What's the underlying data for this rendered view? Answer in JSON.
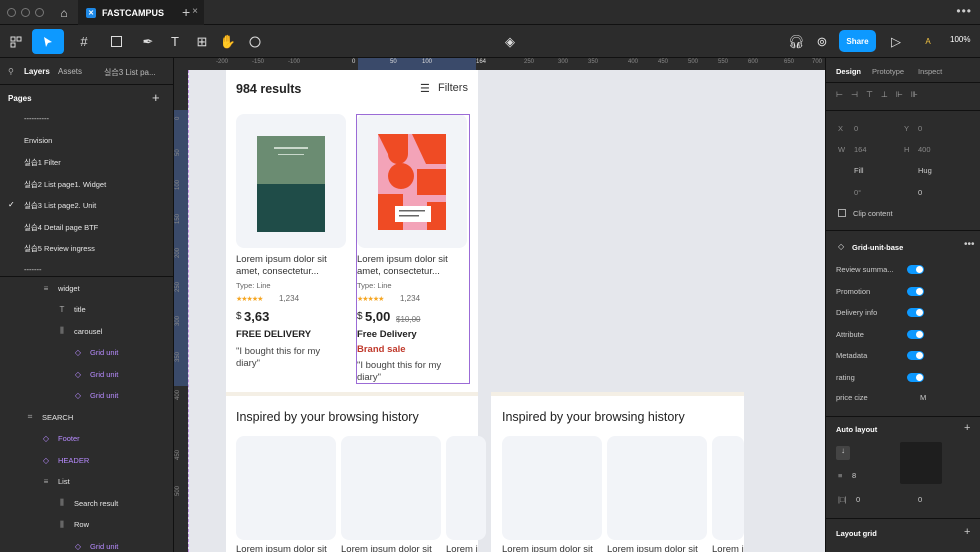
{
  "tabbar": {
    "file_name": "FASTCAMPUS",
    "close": "×",
    "new_tab": "+",
    "more": "•••"
  },
  "toolbar": {
    "share_label": "Share",
    "zoom": "100%",
    "avatar": "A"
  },
  "left_panel": {
    "tabs": {
      "layers": "Layers",
      "assets": "Assets",
      "page_name": "실습3 List pa..."
    },
    "pages_title": "Pages",
    "add": "+",
    "pages": [
      {
        "label": "----------",
        "current": false
      },
      {
        "label": "Envision",
        "current": false
      },
      {
        "label": "실습1 Filter",
        "current": false
      },
      {
        "label": "실습2 List page1. Widget",
        "current": false
      },
      {
        "label": "실습3 List page2. Unit",
        "current": true
      },
      {
        "label": "실습4 Detail page BTF",
        "current": false
      },
      {
        "label": "실습5 Review ingress",
        "current": false
      },
      {
        "label": "-------",
        "current": false
      }
    ],
    "layers": [
      {
        "label": "widget",
        "icon": "≡",
        "comp": false
      },
      {
        "label": "title",
        "icon": "T",
        "comp": false
      },
      {
        "label": "carousel",
        "icon": "⫼",
        "comp": false
      },
      {
        "label": "Grid unit",
        "icon": "◇",
        "comp": true
      },
      {
        "label": "Grid unit",
        "icon": "◇",
        "comp": true
      },
      {
        "label": "Grid unit",
        "icon": "◇",
        "comp": true
      },
      {
        "label": "SEARCH",
        "icon": "⌗",
        "comp": false
      },
      {
        "label": "Footer",
        "icon": "◇",
        "comp": true
      },
      {
        "label": "HEADER",
        "icon": "◇",
        "comp": true
      },
      {
        "label": "List",
        "icon": "≡",
        "comp": false
      },
      {
        "label": "Search result",
        "icon": "⫼",
        "comp": false
      },
      {
        "label": "Row",
        "icon": "⫼",
        "comp": false
      },
      {
        "label": "Grid unit",
        "icon": "◇",
        "comp": true
      }
    ]
  },
  "ruler": {
    "h": [
      "-200",
      "-150",
      "-100",
      "0",
      "50",
      "100",
      "164",
      "250",
      "300",
      "350",
      "400",
      "450",
      "500",
      "550",
      "600",
      "650",
      "700"
    ],
    "v": [
      "0",
      "50",
      "100",
      "150",
      "200",
      "250",
      "300",
      "350",
      "400",
      "450",
      "500"
    ]
  },
  "canvas": {
    "results": "984 results",
    "filters": "Filters",
    "products": [
      {
        "title1": "Lorem ipsum dolor sit",
        "title2": "amet, consectetur...",
        "type": "Type: Line",
        "rating": "1,234",
        "currency": "$",
        "price": "3,63",
        "old_price": "",
        "delivery": "FREE DELIVERY",
        "badge": "",
        "review1": "\"I bought this for my",
        "review2": "diary\""
      },
      {
        "title1": "Lorem ipsum dolor sit",
        "title2": "amet, consectetur...",
        "type": "Type: Line",
        "rating": "1,234",
        "currency": "$",
        "price": "5,00",
        "old_price": "$10,00",
        "delivery": "Free Delivery",
        "badge": "Brand sale",
        "review1": "\"I bought this for my",
        "review2": "diary\""
      }
    ],
    "history_title": "Inspired by your browsing history",
    "history_item": "Lorem ipsum dolor sit",
    "history_item_cut": "Lorem i"
  },
  "right_panel": {
    "tabs": {
      "design": "Design",
      "prototype": "Prototype",
      "inspect": "Inspect"
    },
    "x_label": "X",
    "x_val": "0",
    "y_label": "Y",
    "y_val": "0",
    "w_label": "W",
    "w_val": "164",
    "h_label": "H",
    "h_val": "400",
    "fill": "Fill",
    "hug": "Hug",
    "rotation": "0°",
    "radius": "0",
    "clip": "Clip content",
    "component_name": "Grid-unit-base",
    "props": [
      {
        "label": "Review summa...",
        "type": "toggle"
      },
      {
        "label": "Promotion",
        "type": "toggle"
      },
      {
        "label": "Delivery info",
        "type": "toggle"
      },
      {
        "label": "Attribute",
        "type": "toggle"
      },
      {
        "label": "Metadata",
        "type": "toggle"
      },
      {
        "label": "rating",
        "type": "toggle"
      }
    ],
    "price_label": "price cize",
    "price_val": "M",
    "auto_layout": "Auto layout",
    "spacing": "8",
    "padding_h": "0",
    "padding_v": "0",
    "layout_grid": "Layout grid"
  },
  "colors": {
    "accent": "#0d99ff",
    "component": "#b78bff",
    "selection": "#9b6bd6",
    "brand_sale": "#c0392b"
  }
}
